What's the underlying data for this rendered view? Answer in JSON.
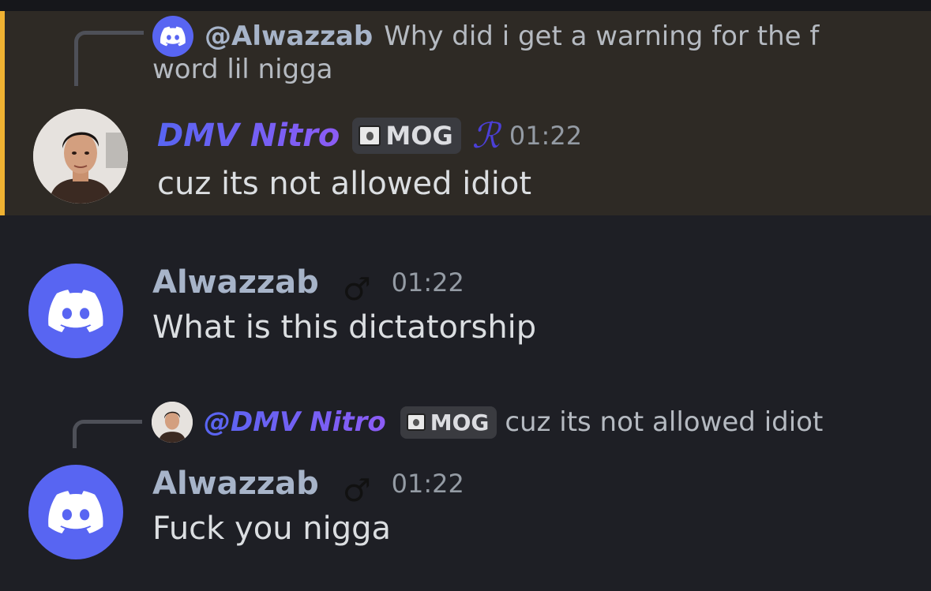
{
  "colors": {
    "background": "#1e1f25",
    "highlight": "#2e2a25",
    "accent_bar": "#f0b232",
    "blurple": "#5865f2"
  },
  "messages": [
    {
      "reply": {
        "author": "@Alwazzab",
        "text": "Why did i get a warning for the f",
        "text_wrap": "word lil nigga",
        "avatar_icon": "discord-logo-icon"
      },
      "author": "DMV Nitro",
      "tag": "MOG",
      "role_icon": "script-r-icon",
      "role_glyph": "ℛ",
      "timestamp": "01:22",
      "content": "cuz its not allowed idiot",
      "avatar": "profile-photo"
    },
    {
      "author": "Alwazzab",
      "gender_glyph": "♂",
      "timestamp": "01:22",
      "content": "What is this dictatorship",
      "avatar": "discord-logo-icon"
    },
    {
      "reply": {
        "author": "@DMV Nitro",
        "tag": "MOG",
        "text": "cuz its not allowed idiot",
        "avatar_icon": "profile-photo"
      },
      "author": "Alwazzab",
      "gender_glyph": "♂",
      "timestamp": "01:22",
      "content": "Fuck you nigga",
      "avatar": "discord-logo-icon"
    }
  ]
}
